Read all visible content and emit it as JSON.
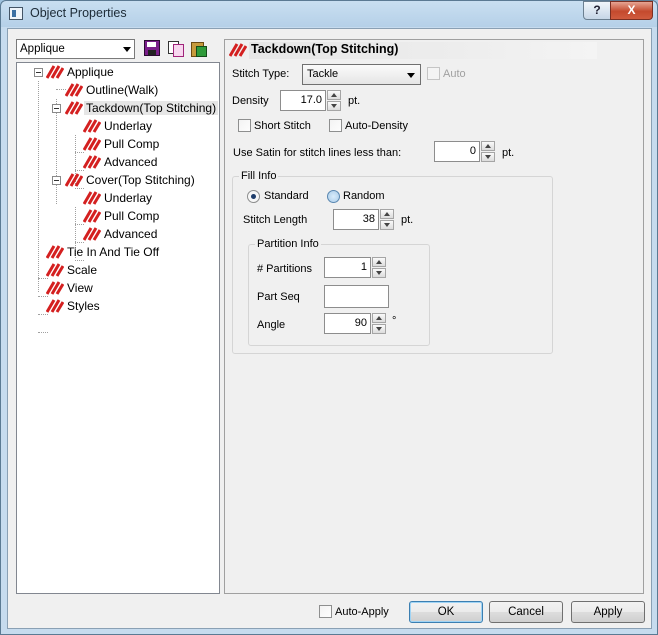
{
  "window": {
    "title": "Object Properties",
    "help_label": "?",
    "close_label": "X"
  },
  "left": {
    "dropdown_value": "Applique",
    "tree": [
      {
        "label": "Applique"
      },
      {
        "label": "Outline(Walk)"
      },
      {
        "label": "Tackdown(Top Stitching)"
      },
      {
        "label": "Underlay"
      },
      {
        "label": "Pull Comp"
      },
      {
        "label": "Advanced"
      },
      {
        "label": "Cover(Top Stitching)"
      },
      {
        "label": "Underlay"
      },
      {
        "label": "Pull Comp"
      },
      {
        "label": "Advanced"
      },
      {
        "label": "Tie In And Tie Off"
      },
      {
        "label": "Scale"
      },
      {
        "label": "View"
      },
      {
        "label": "Styles"
      }
    ]
  },
  "panel": {
    "title": "Tackdown(Top Stitching)",
    "stitch_type_label": "Stitch Type:",
    "stitch_type_value": "Tackle",
    "auto_label": "Auto",
    "density_label": "Density",
    "density_value": "17.0",
    "density_unit": "pt.",
    "short_stitch_label": "Short Stitch",
    "auto_density_label": "Auto-Density",
    "satin_label": "Use Satin for stitch lines less than:",
    "satin_value": "0",
    "satin_unit": "pt.",
    "fill_info": {
      "label": "Fill Info",
      "standard_label": "Standard",
      "random_label": "Random",
      "stitch_length_label": "Stitch Length",
      "stitch_length_value": "38",
      "stitch_length_unit": "pt.",
      "partition": {
        "label": "Partition Info",
        "partitions_label": "# Partitions",
        "partitions_value": "1",
        "part_seq_label": "Part Seq",
        "part_seq_value": "",
        "angle_label": "Angle",
        "angle_value": "90",
        "angle_unit": "°"
      }
    }
  },
  "footer": {
    "auto_apply_label": "Auto-Apply",
    "ok_label": "OK",
    "cancel_label": "Cancel",
    "apply_label": "Apply"
  },
  "colors": {
    "stitch_icon": "#d42020",
    "selected_bg": "#e6e6e6",
    "default_button_border": "#3c7fb1"
  }
}
